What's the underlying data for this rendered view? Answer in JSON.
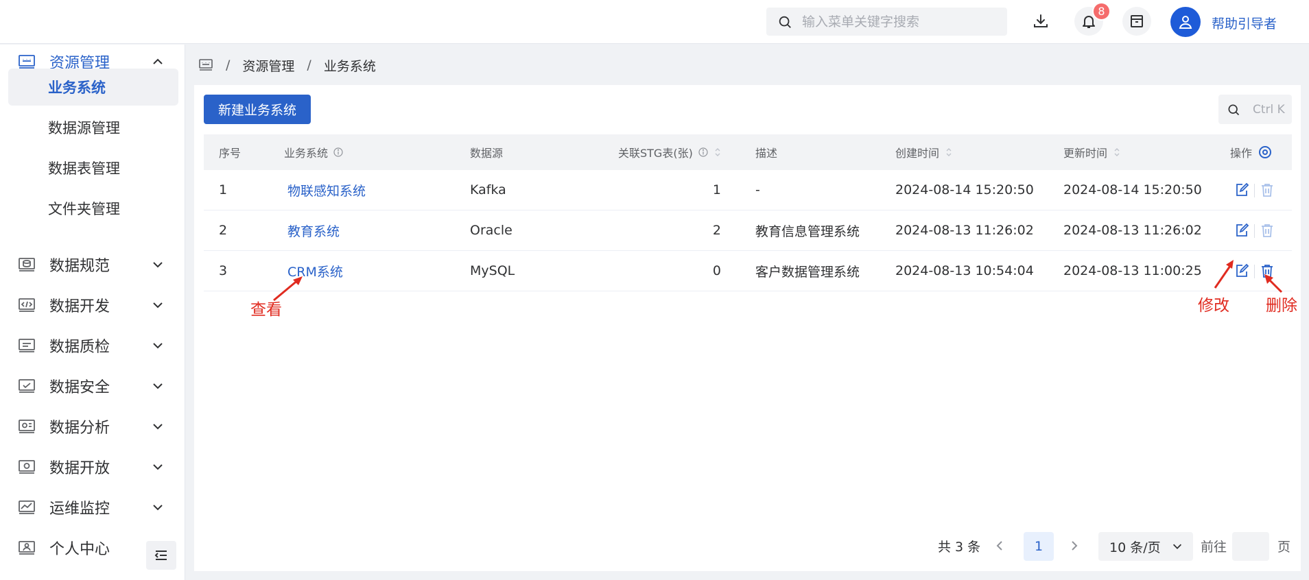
{
  "header": {
    "search_placeholder": "输入菜单关键字搜索",
    "notification_count": "8",
    "user_name": "帮助引导者",
    "icons": [
      "search-icon",
      "download-icon",
      "bell-icon",
      "archive-icon",
      "user-icon"
    ]
  },
  "sidebar": {
    "menu": [
      {
        "label": "资源管理",
        "icon": "keyboard-icon",
        "expanded": true
      },
      {
        "label": "数据规范",
        "icon": "database-icon"
      },
      {
        "label": "数据开发",
        "icon": "code-icon"
      },
      {
        "label": "数据质检",
        "icon": "monitor-icon"
      },
      {
        "label": "数据安全",
        "icon": "shield-monitor-icon"
      },
      {
        "label": "数据分析",
        "icon": "chart-monitor-icon"
      },
      {
        "label": "数据开放",
        "icon": "open-icon"
      },
      {
        "label": "运维监控",
        "icon": "line-chart-icon"
      },
      {
        "label": "个人中心",
        "icon": "person-card-icon"
      }
    ],
    "submenu": [
      "业务系统",
      "数据源管理",
      "数据表管理",
      "文件夹管理"
    ],
    "active_submenu": "业务系统"
  },
  "breadcrumb": {
    "items": [
      "资源管理",
      "业务系统"
    ],
    "separator": "/"
  },
  "toolbar": {
    "new_button": "新建业务系统",
    "search_hint": "Ctrl K"
  },
  "table": {
    "headers": {
      "index": "序号",
      "system": "业务系统",
      "datasource": "数据源",
      "stg_count": "关联STG表(张)",
      "description": "描述",
      "created": "创建时间",
      "updated": "更新时间",
      "actions": "操作"
    },
    "rows": [
      {
        "index": "1",
        "system": "物联感知系统",
        "datasource": "Kafka",
        "stg_count": "1",
        "description": "-",
        "created": "2024-08-14 15:20:50",
        "updated": "2024-08-14 15:20:50"
      },
      {
        "index": "2",
        "system": "教育系统",
        "datasource": "Oracle",
        "stg_count": "2",
        "description": "教育信息管理系统",
        "created": "2024-08-13 11:26:02",
        "updated": "2024-08-13 11:26:02"
      },
      {
        "index": "3",
        "system": "CRM系统",
        "datasource": "MySQL",
        "stg_count": "0",
        "description": "客户数据管理系统",
        "created": "2024-08-13 10:54:04",
        "updated": "2024-08-13 11:00:25"
      }
    ]
  },
  "annotations": {
    "view": "查看",
    "edit": "修改",
    "delete": "删除"
  },
  "pagination": {
    "total": "共 3 条",
    "current_page": "1",
    "page_size": "10 条/页",
    "goto_prefix": "前往",
    "goto_suffix": "页"
  },
  "colors": {
    "primary": "#2a62c9",
    "annotation": "#e02b20",
    "badge": "#f56c6c"
  }
}
